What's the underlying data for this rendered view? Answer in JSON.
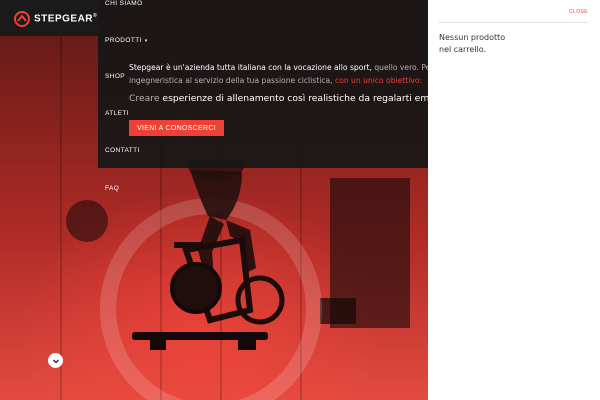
{
  "brand": {
    "name": "STEPGEAR",
    "mark": "®"
  },
  "nav": {
    "items": [
      {
        "label": "CHI SIAMO"
      },
      {
        "label": "PRODOTTI",
        "caret": "▾"
      },
      {
        "label": "SHOP"
      },
      {
        "label": "ATLETI"
      },
      {
        "label": "CONTATTI"
      }
    ],
    "faq": "FAQ"
  },
  "hero": {
    "line1_a": "Stepgear è un'azienda tutta italiana con la vocazione allo sport,",
    "line1_b": " quello vero. Per qu",
    "line2_a": "ingegneristica al servizio della tua passione ciclistica,",
    "line2_b": " con un unico obiettivo:",
    "lead_a": "Creare",
    "lead_b": " esperienze di allenamento così realistiche da regalarti emozioni au",
    "cta_label": "VIENI A CONOSCERCI"
  },
  "cart": {
    "close_label": "CLOSE",
    "empty_line1": "Nessun prodotto",
    "empty_line2": "nel carrello."
  },
  "colors": {
    "accent": "#ef4036",
    "nav_bg": "#1b1a1a",
    "panel_bg": "#ffffff"
  },
  "icons": {
    "logo": "stepgear-logo-icon",
    "scroll": "chevron-down-icon"
  }
}
